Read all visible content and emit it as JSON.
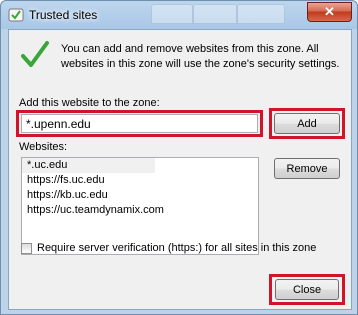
{
  "window": {
    "title": "Trusted sites",
    "close_glyph": "✕"
  },
  "info": {
    "icon": "checkmark-icon",
    "text": "You can add and remove websites from this zone. All websites in this zone will use the zone's security settings."
  },
  "add_section": {
    "label": "Add this website to the zone:",
    "input_value": "*.upenn.edu",
    "add_button": "Add"
  },
  "websites": {
    "label": "Websites:",
    "items": [
      "*.uc.edu",
      "https://fs.uc.edu",
      "https://kb.uc.edu",
      "https://uc.teamdynamix.com"
    ],
    "remove_button": "Remove"
  },
  "verification": {
    "label": "Require server verification (https:) for all sites in this zone",
    "checked": false
  },
  "footer": {
    "close_button": "Close"
  },
  "colors": {
    "highlight": "#d0142a",
    "check_green": "#3aa63a"
  }
}
